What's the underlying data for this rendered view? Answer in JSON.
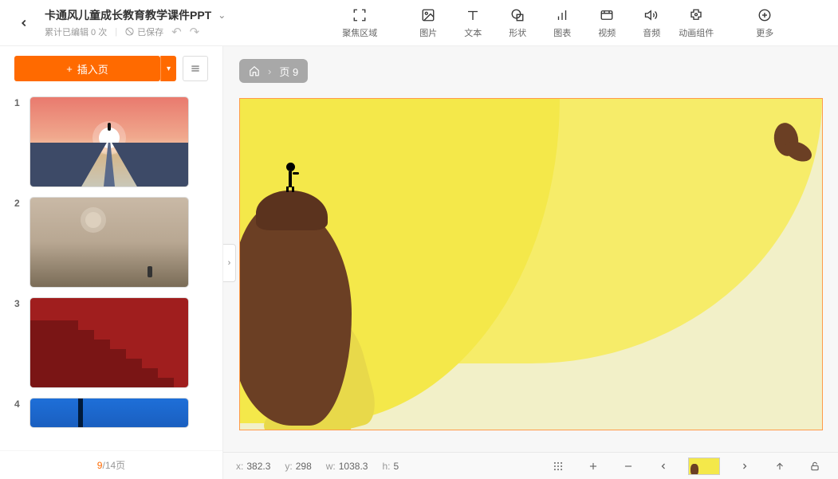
{
  "header": {
    "title": "卡通风儿童成长教育教学课件PPT",
    "edit_count_text": "累计已编辑 0 次",
    "saved_text": "已保存"
  },
  "toolbar": {
    "focus": "聚焦区域",
    "image": "图片",
    "text": "文本",
    "shape": "形状",
    "chart": "图表",
    "video": "视频",
    "audio": "音频",
    "anim": "动画组件",
    "more": "更多"
  },
  "sidebar": {
    "insert_label": "插入页",
    "thumbs": [
      {
        "num": "1"
      },
      {
        "num": "2"
      },
      {
        "num": "3"
      },
      {
        "num": "4"
      }
    ],
    "pager_current": "9",
    "pager_sep": "/",
    "pager_total": "14页"
  },
  "breadcrumb": {
    "page_label": "页 9"
  },
  "status": {
    "x_label": "x:",
    "x_val": "382.3",
    "y_label": "y:",
    "y_val": "298",
    "w_label": "w:",
    "w_val": "1038.3",
    "h_label": "h:",
    "h_val": "5"
  }
}
